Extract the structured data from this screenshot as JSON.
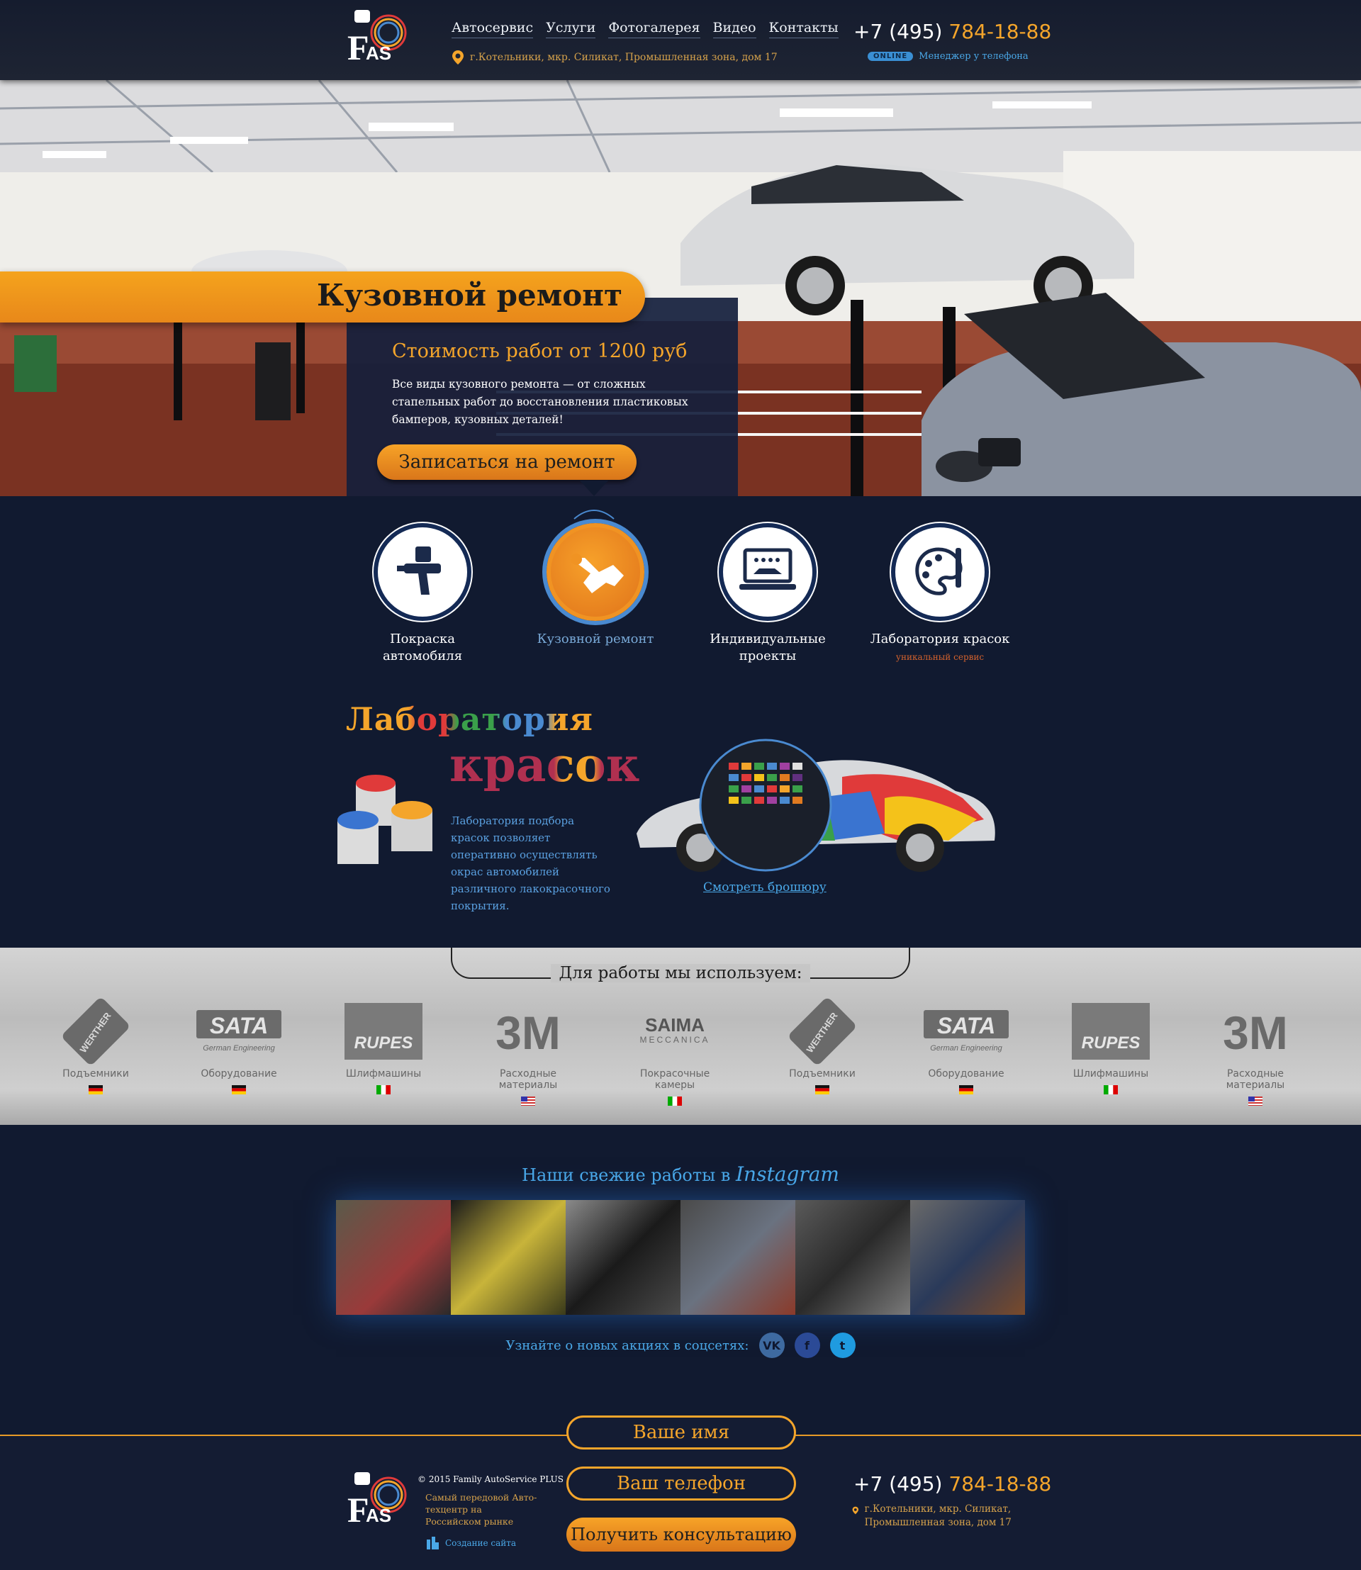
{
  "header": {
    "nav": [
      "Автосервис",
      "Услуги",
      "Фотогалерея",
      "Видео",
      "Контакты"
    ],
    "address": "г.Котельники, мкр. Силикат, Промышленная зона, дом 17",
    "phone_prefix": "+7 (495)",
    "phone_number": "784-18-88",
    "online_badge": "ONLINE",
    "manager_text": "Менеджер у телефона"
  },
  "hero": {
    "title": "Кузовной ремонт",
    "price": "Стоимость работ от 1200 руб",
    "description": "Все виды кузовного ремонта — от сложных стапельных работ до восстановления пластиковых бамперов, кузовных деталей!",
    "button": "Записаться на ремонт"
  },
  "services": [
    {
      "label": "Покраска автомобиля",
      "icon": "spray-gun-icon",
      "sub": ""
    },
    {
      "label": "Кузовной ремонт",
      "icon": "wrench-car-icon",
      "sub": "",
      "active": true
    },
    {
      "label": "Индивидуальные проекты",
      "icon": "laptop-car-icon",
      "sub": ""
    },
    {
      "label": "Лаборатория красок",
      "icon": "palette-icon",
      "sub": "уникальный сервис"
    }
  ],
  "lab": {
    "title_line1": "Лаборатория",
    "title_line2": "красок",
    "text": "Лаборатория подбора красок позволяет оперативно осуществлять окрас автомобилей различного лакокрасочного покрытия.",
    "link": "Смотреть брошюру"
  },
  "brands": {
    "title": "Для работы мы используем:",
    "items": [
      {
        "logo": "WERTHER",
        "label": "Подъемники",
        "flag": "de"
      },
      {
        "logo": "SATA",
        "logo_sub": "German Engineering",
        "label": "Оборудование",
        "flag": "de"
      },
      {
        "logo": "RUPES",
        "label": "Шлифмашины",
        "flag": "it"
      },
      {
        "logo": "3M",
        "label": "Расходные материалы",
        "flag": "us"
      },
      {
        "logo": "SAIMA",
        "logo_sub": "MECCANICA",
        "label": "Покрасочные камеры",
        "flag": "it"
      },
      {
        "logo": "WERTHER",
        "label": "Подъемники",
        "flag": "de"
      },
      {
        "logo": "SATA",
        "logo_sub": "German Engineering",
        "label": "Оборудование",
        "flag": "de"
      },
      {
        "logo": "RUPES",
        "label": "Шлифмашины",
        "flag": "it"
      },
      {
        "logo": "3M",
        "label": "Расходные материалы",
        "flag": "us"
      }
    ]
  },
  "instagram": {
    "title": "Наши свежие работы в",
    "brand": "Instagram",
    "social_text": "Узнайте о новых акциях в соцсетях:"
  },
  "footer": {
    "copyright": "© 2015 Family AutoService PLUS",
    "slogan": "Самый передовой Авто-техцентр на Российском рынке",
    "create": "Создание сайта",
    "name_placeholder": "Ваше имя",
    "phone_placeholder": "Ваш телефон",
    "button": "Получить консультацию",
    "phone_prefix": "+7 (495)",
    "phone_number": "784-18-88",
    "address": "г.Котельники, мкр. Силикат, Промышленная зона, дом 17"
  },
  "colors": {
    "accent": "#f4a52b",
    "link": "#4aa8e8",
    "navy": "#111a30"
  }
}
